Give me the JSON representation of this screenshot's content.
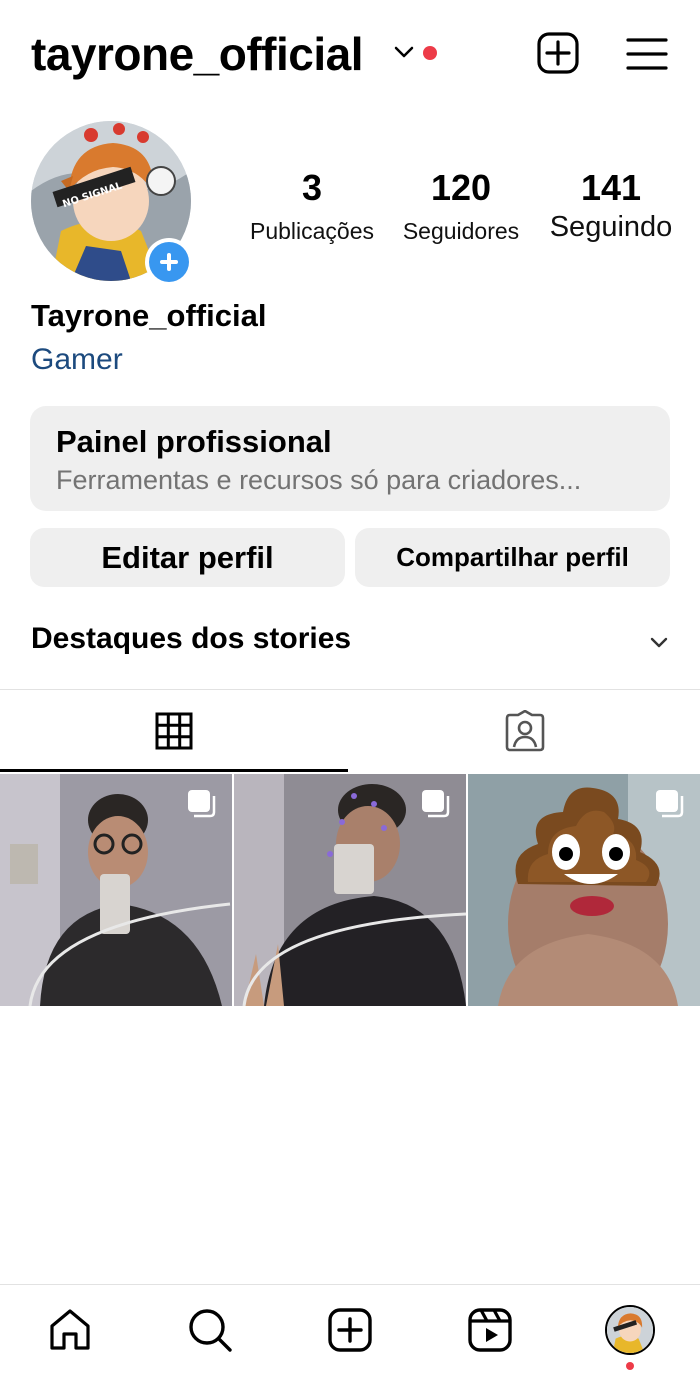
{
  "header": {
    "username": "tayrone_official",
    "icons": {
      "account_switch": "chevron-down-icon",
      "create": "plus-square-icon",
      "menu": "hamburger-menu-icon"
    }
  },
  "profile": {
    "avatar_text": "NO SIGNAL",
    "stats": [
      {
        "value": "3",
        "label": "Publicações"
      },
      {
        "value": "120",
        "label": "Seguidores"
      },
      {
        "value": "141",
        "label": "Seguindo"
      }
    ],
    "name": "Tayrone_official",
    "category": "Gamer"
  },
  "pro_panel": {
    "title": "Painel profissional",
    "subtitle": "Ferramentas e recursos só para criadores..."
  },
  "buttons": {
    "edit": "Editar perfil",
    "share": "Compartilhar perfil"
  },
  "highlights": {
    "title": "Destaques dos stories"
  },
  "tabs": [
    {
      "icon": "grid-icon",
      "active": true
    },
    {
      "icon": "tagged-icon",
      "active": false
    }
  ],
  "bottom_nav": [
    "home-icon",
    "search-icon",
    "create-icon",
    "reels-icon",
    "profile-avatar"
  ],
  "colors": {
    "accent_blue": "#3897f0",
    "notification_red": "#ed3b48",
    "link_blue": "#1c4a7e",
    "panel_gray": "#efefef"
  }
}
